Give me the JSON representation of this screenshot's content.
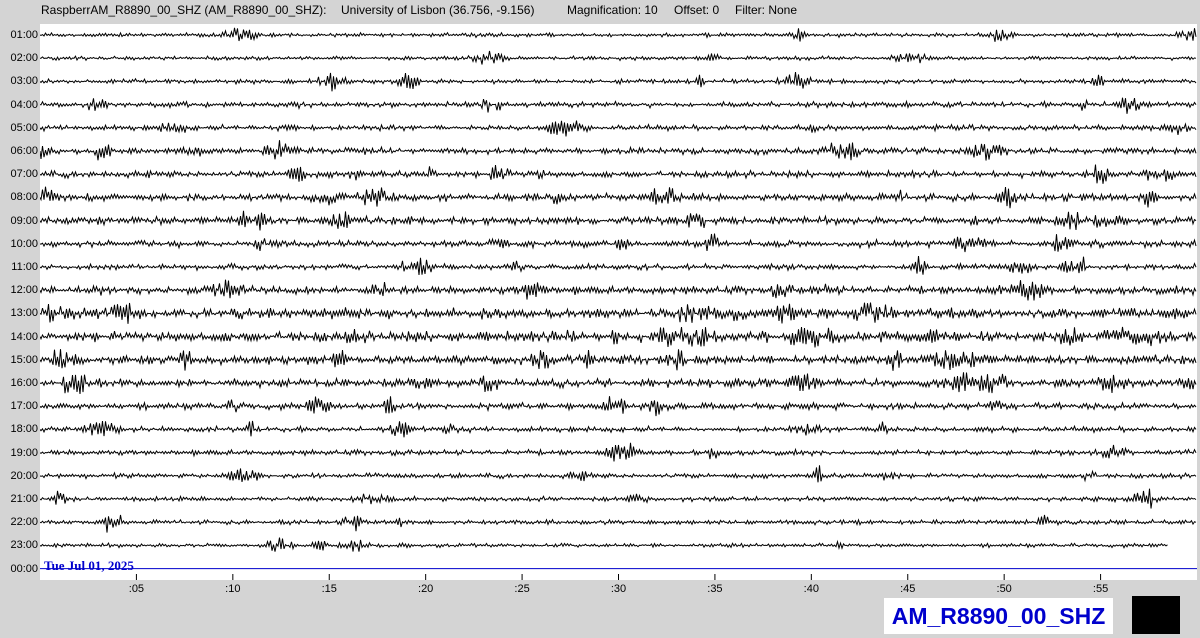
{
  "header": {
    "station_title": "RaspberrAM_R8890_00_SHZ (AM_R8890_00_SHZ):",
    "location": "University of Lisbon (36.756, -9.156)",
    "magnification": "Magnification: 10",
    "offset": "Offset: 0",
    "filter": "Filter: None"
  },
  "date_label": "Tue Jul 01, 2025",
  "station_box_label": "AM_R8890_00_SHZ",
  "colors": {
    "trace": "#000000",
    "current_line": "#0000cc",
    "background": "#d4d4d4",
    "plot_background": "#ffffff",
    "label_blue": "#0000cc"
  },
  "chart_data": {
    "type": "line",
    "hours": [
      "01:00",
      "02:00",
      "03:00",
      "04:00",
      "05:00",
      "06:00",
      "07:00",
      "08:00",
      "09:00",
      "10:00",
      "11:00",
      "12:00",
      "13:00",
      "14:00",
      "15:00",
      "16:00",
      "17:00",
      "18:00",
      "19:00",
      "20:00",
      "21:00",
      "22:00",
      "23:00",
      "00:00"
    ],
    "minute_ticks": [
      ":05",
      ":10",
      ":15",
      ":20",
      ":25",
      ":30",
      ":35",
      ":40",
      ":45",
      ":50",
      ":55"
    ],
    "minute_values": [
      5,
      10,
      15,
      20,
      25,
      30,
      35,
      40,
      45,
      50,
      55
    ],
    "xlim": [
      0,
      60
    ],
    "activity_level": [
      0.15,
      0.12,
      0.2,
      0.3,
      0.3,
      0.4,
      0.45,
      0.55,
      0.55,
      0.45,
      0.35,
      0.55,
      0.85,
      0.9,
      0.7,
      0.6,
      0.45,
      0.3,
      0.28,
      0.25,
      0.22,
      0.2,
      0.15,
      0
    ],
    "last_trace_end_minute": 58.5,
    "grid": false
  }
}
